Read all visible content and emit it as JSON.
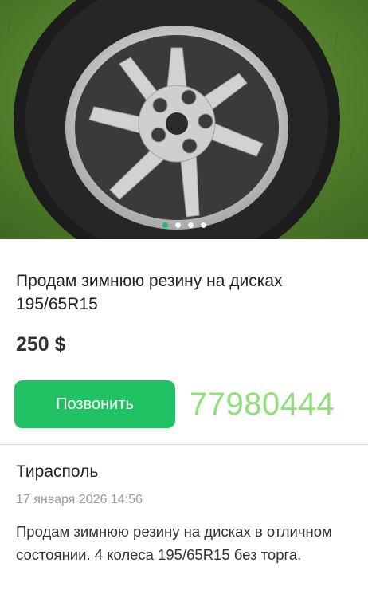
{
  "listing": {
    "title": "Продам зимнюю резину на дисках 195/65R15",
    "price": "250 $",
    "call_label": "Позвонить",
    "phone": "77980444",
    "city": "Тирасполь",
    "date": "17 января 2026 14:56",
    "description": "Продам зимнюю резину на дисках в отличном состоянии. 4 колеса 195/65R15 без торга."
  },
  "gallery": {
    "image_count": 4,
    "active_index": 0
  },
  "colors": {
    "accent": "#21c264",
    "phone": "#8fe07a",
    "muted": "#9a9a9a"
  }
}
